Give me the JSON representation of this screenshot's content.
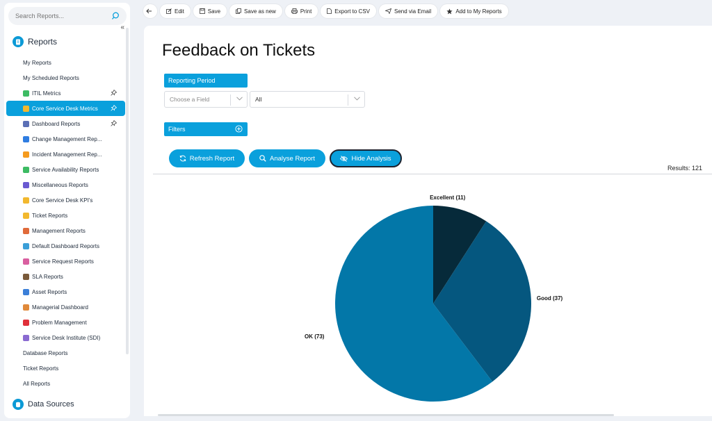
{
  "sidebar": {
    "search_placeholder": "Search Reports...",
    "collapse_icon": "double-chevron-left",
    "section_title": "Reports",
    "items": [
      {
        "label": "My Reports"
      },
      {
        "label": "My Scheduled Reports"
      },
      {
        "label": "ITIL Metrics",
        "icon": "check-square",
        "color": "#3dbb63",
        "pinned": true
      },
      {
        "label": "Core Service Desk Metrics",
        "icon": "ticket",
        "color": "#f2b82e",
        "pinned": true,
        "active": true
      },
      {
        "label": "Dashboard Reports",
        "icon": "dashboard",
        "color": "#5b6fb5",
        "pinned": true
      },
      {
        "label": "Change Management Rep...",
        "icon": "change",
        "color": "#2f7de1"
      },
      {
        "label": "Incident Management Rep...",
        "icon": "warning",
        "color": "#f59b1e"
      },
      {
        "label": "Service Availability Reports",
        "icon": "plus-box",
        "color": "#3dbb63"
      },
      {
        "label": "Miscellaneous Reports",
        "icon": "cross",
        "color": "#6a5ad1"
      },
      {
        "label": "Core Service Desk KPI's",
        "icon": "ticket",
        "color": "#f2b82e"
      },
      {
        "label": "Ticket Reports",
        "icon": "ticket",
        "color": "#f2b82e"
      },
      {
        "label": "Management Reports",
        "icon": "pyramid",
        "color": "#e06a3a"
      },
      {
        "label": "Default Dashboard Reports",
        "icon": "book",
        "color": "#3b9fd8"
      },
      {
        "label": "Service Request Reports",
        "icon": "request",
        "color": "#d95fa0"
      },
      {
        "label": "SLA Reports",
        "icon": "clock",
        "color": "#7a5a3a"
      },
      {
        "label": "Asset Reports",
        "icon": "monitor",
        "color": "#3b7fd8"
      },
      {
        "label": "Managerial Dashboard",
        "icon": "person",
        "color": "#e0893a"
      },
      {
        "label": "Problem Management",
        "icon": "flag",
        "color": "#e0303a"
      },
      {
        "label": "Service Desk Institute (SDI)",
        "icon": "tools",
        "color": "#8a6ad1"
      },
      {
        "label": "Database Reports"
      },
      {
        "label": "Ticket Reports"
      },
      {
        "label": "All Reports"
      }
    ],
    "data_sources_label": "Data Sources"
  },
  "toolbar": {
    "back_icon": "arrow-left",
    "edit": "Edit",
    "save": "Save",
    "save_as_new": "Save as new",
    "print": "Print",
    "export_csv": "Export to CSV",
    "send_email": "Send via Email",
    "add_to_my_reports": "Add to My Reports"
  },
  "main": {
    "title": "Feedback on Tickets",
    "reporting_period_label": "Reporting Period",
    "field_placeholder": "Choose a Field",
    "period_value": "All",
    "filters_label": "Filters",
    "refresh_button": "Refresh Report",
    "analyse_button": "Analyse Report",
    "hide_analysis_button": "Hide Analysis",
    "results": "Results: 121"
  },
  "chart_data": {
    "type": "pie",
    "slices": [
      {
        "label": "Excellent (11)",
        "value": 11,
        "color": "#062a3a"
      },
      {
        "label": "Good (37)",
        "value": 37,
        "color": "#05577f"
      },
      {
        "label": "OK (73)",
        "value": 73,
        "color": "#0377a8"
      }
    ]
  }
}
